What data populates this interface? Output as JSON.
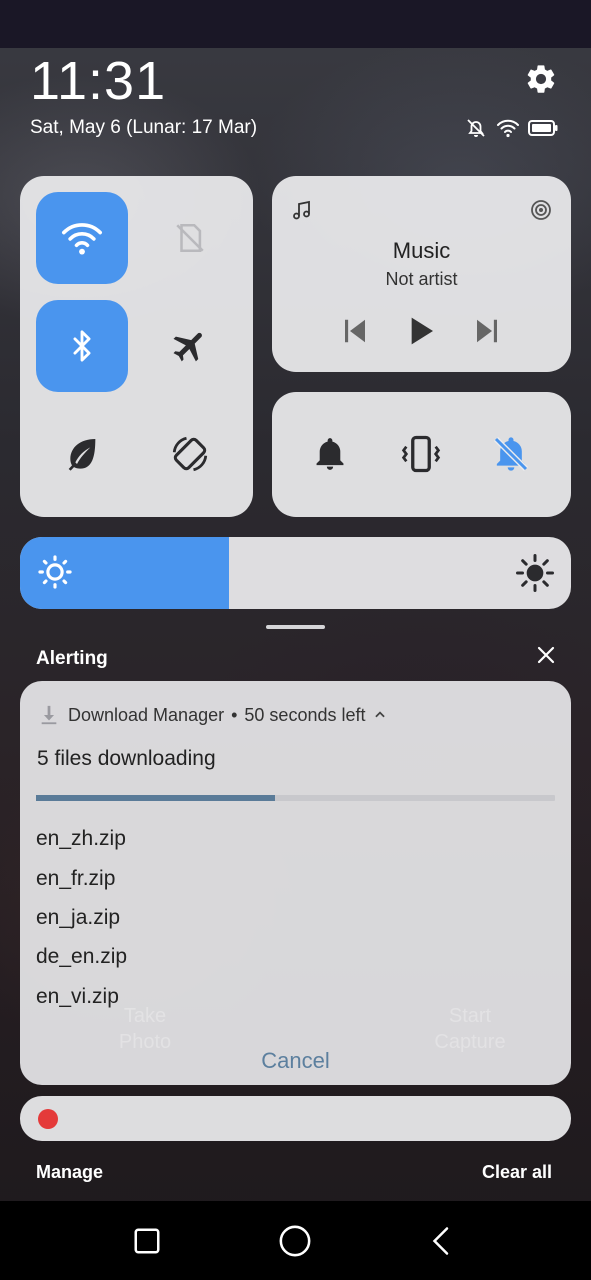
{
  "status": {
    "time": "11:31",
    "date": "Sat, May 6 (Lunar: 17 Mar)",
    "icons": [
      "notifications-off-icon",
      "wifi-icon",
      "battery-icon"
    ]
  },
  "quick_settings": {
    "toggles": [
      {
        "name": "wifi",
        "on": true
      },
      {
        "name": "sim-disabled",
        "on": false
      },
      {
        "name": "bluetooth",
        "on": true
      },
      {
        "name": "airplane-mode",
        "on": false
      },
      {
        "name": "power-saving",
        "on": false
      },
      {
        "name": "auto-rotate",
        "on": false
      }
    ],
    "accent_color": "#4a95ee"
  },
  "media": {
    "title": "Music",
    "artist": "Not artist"
  },
  "sound_modes": [
    "ring",
    "vibrate",
    "mute"
  ],
  "sound_mode_active": "mute",
  "brightness": {
    "level": 0.38
  },
  "notifications": {
    "section_label": "Alerting",
    "download": {
      "app": "Download Manager",
      "separator": "•",
      "time_left": "50 seconds left",
      "title": "5 files downloading",
      "progress": 0.46,
      "files": [
        "en_zh.zip",
        "en_fr.zip",
        "en_ja.zip",
        "de_en.zip",
        "en_vi.zip"
      ],
      "action": "Cancel"
    },
    "background_labels": {
      "left": "Take\nPhoto",
      "right": "Start\nCapture"
    }
  },
  "footer": {
    "manage": "Manage",
    "clear_all": "Clear all"
  }
}
